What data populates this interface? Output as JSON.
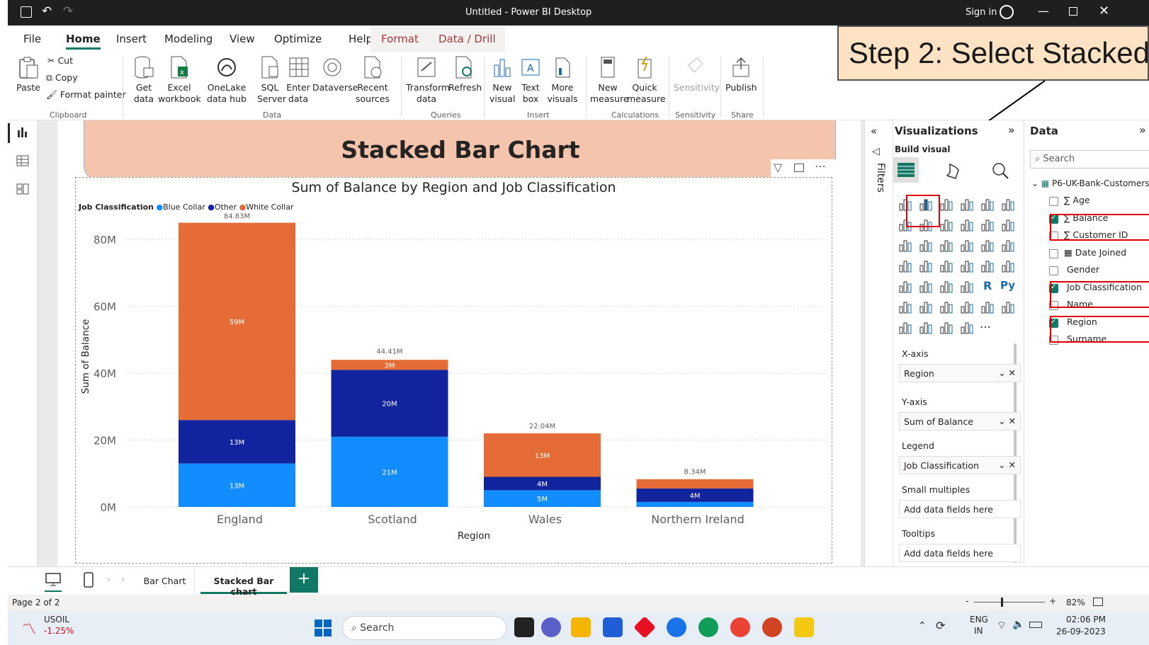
{
  "titlebar": {
    "title": "Untitled - Power BI Desktop",
    "signin": "Sign in"
  },
  "ribbon_tabs": [
    "File",
    "Home",
    "Insert",
    "Modeling",
    "View",
    "Optimize",
    "Help",
    "Format",
    "Data / Drill"
  ],
  "clipboard": {
    "paste": "Paste",
    "cut": "Cut",
    "copy": "Copy",
    "format_painter": "Format painter",
    "group": "Clipboard"
  },
  "data_group": {
    "get_data": "Get data",
    "excel": "Excel workbook",
    "onelake": "OneLake data hub",
    "sql": "SQL Server",
    "enter": "Enter data",
    "dataverse": "Dataverse",
    "recent": "Recent sources",
    "group": "Data"
  },
  "queries": {
    "transform": "Transform data",
    "refresh": "Refresh",
    "group": "Queries"
  },
  "insert": {
    "new_visual": "New visual",
    "text_box": "Text box",
    "more_visuals": "More visuals",
    "group": "Insert"
  },
  "calculations": {
    "new_measure": "New measure",
    "quick_measure": "Quick measure",
    "group": "Calculations"
  },
  "sensitivity": {
    "label": "Sensitivity",
    "group": "Sensitivity"
  },
  "share": {
    "publish": "Publish",
    "group": "Share"
  },
  "callout": "Step 2: Select Stacked",
  "report": {
    "banner_title": "Stacked Bar Chart",
    "chart_title": "Sum of Balance by Region and Job Classification",
    "legend_title": "Job Classification",
    "legend": [
      {
        "name": "Blue Collar",
        "color": "#118dff"
      },
      {
        "name": "Other",
        "color": "#12239e"
      },
      {
        "name": "White Collar",
        "color": "#e66c37"
      }
    ]
  },
  "chart_data": {
    "type": "bar",
    "stacked": true,
    "title": "Sum of Balance by Region and Job Classification",
    "xlabel": "Region",
    "ylabel": "Sum of Balance",
    "categories": [
      "England",
      "Scotland",
      "Wales",
      "Northern Ireland"
    ],
    "yticks": [
      "0M",
      "20M",
      "40M",
      "60M",
      "80M"
    ],
    "ylim": [
      0,
      90
    ],
    "series": [
      {
        "name": "Blue Collar",
        "color": "#118dff",
        "values": [
          13,
          21,
          5,
          1.5
        ],
        "labels": [
          "13M",
          "21M",
          "5M",
          ""
        ]
      },
      {
        "name": "Other",
        "color": "#12239e",
        "values": [
          13,
          20,
          4,
          4
        ],
        "labels": [
          "13M",
          "20M",
          "4M",
          "4M"
        ]
      },
      {
        "name": "White Collar",
        "color": "#e66c37",
        "values": [
          59,
          3,
          13,
          2.8
        ],
        "labels": [
          "59M",
          "3M",
          "13M",
          ""
        ]
      }
    ],
    "totals": [
      "84.83M",
      "44.41M",
      "22.04M",
      "8.34M"
    ],
    "total_values": [
      84.83,
      44.41,
      22.04,
      8.34
    ],
    "legend_position": "top-left",
    "grid": true
  },
  "pages": {
    "tabs": [
      "Bar Chart",
      "Stacked Bar chart"
    ],
    "active": "Stacked Bar chart"
  },
  "status": {
    "page": "Page 2 of 2",
    "zoom": "82%"
  },
  "filters": {
    "label": "Filters"
  },
  "viz": {
    "title": "Visualizations",
    "build": "Build visual",
    "wells": [
      {
        "label": "X-axis",
        "value": "Region"
      },
      {
        "label": "Y-axis",
        "value": "Sum of Balance"
      },
      {
        "label": "Legend",
        "value": "Job Classification"
      },
      {
        "label": "Small multiples",
        "value": "Add data fields here"
      },
      {
        "label": "Tooltips",
        "value": "Add data fields here"
      }
    ]
  },
  "data_pane": {
    "title": "Data",
    "search_placeholder": "Search",
    "table": "P6-UK-Bank-Customers",
    "fields": [
      {
        "name": "Age",
        "checked": false,
        "sigma": true
      },
      {
        "name": "Balance",
        "checked": true,
        "sigma": true
      },
      {
        "name": "Customer ID",
        "checked": false,
        "sigma": true
      },
      {
        "name": "Date Joined",
        "checked": false,
        "sigma": false
      },
      {
        "name": "Gender",
        "checked": false,
        "sigma": false
      },
      {
        "name": "Job Classification",
        "checked": true,
        "sigma": false
      },
      {
        "name": "Name",
        "checked": false,
        "sigma": false
      },
      {
        "name": "Region",
        "checked": true,
        "sigma": false
      },
      {
        "name": "Surname",
        "checked": false,
        "sigma": false
      }
    ]
  },
  "taskbar": {
    "stock_name": "USOIL",
    "stock_change": "-1.25%",
    "search": "Search",
    "lang1": "ENG",
    "lang2": "IN",
    "time": "02:06 PM",
    "date": "26-09-2023"
  }
}
